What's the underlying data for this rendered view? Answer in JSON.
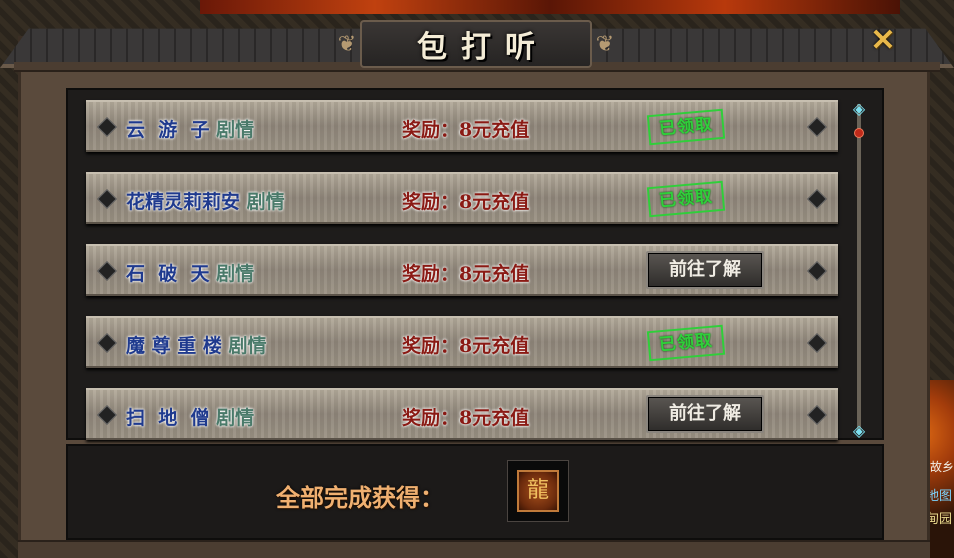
{
  "window": {
    "title": "包打听",
    "close_glyph": "✕"
  },
  "quests": [
    {
      "name": "云  游  子",
      "tag": "剧情",
      "reward_label": "奖励：",
      "reward_value": "8元充值",
      "status": "claimed",
      "status_text": "已领取"
    },
    {
      "name": "花精灵莉莉安",
      "tag": "剧情",
      "reward_label": "奖励：",
      "reward_value": "8元充值",
      "status": "claimed",
      "status_text": "已领取"
    },
    {
      "name": "石  破  天",
      "tag": "剧情",
      "reward_label": "奖励：",
      "reward_value": "8元充值",
      "status": "goto",
      "status_text": "前往了解"
    },
    {
      "name": "魔 尊 重 楼",
      "tag": "剧情",
      "reward_label": "奖励：",
      "reward_value": "8元充值",
      "status": "claimed",
      "status_text": "已领取"
    },
    {
      "name": "扫  地  僧",
      "tag": "剧情",
      "reward_label": "奖励：",
      "reward_value": "8元充值",
      "status": "goto",
      "status_text": "前往了解"
    }
  ],
  "completion": {
    "label": "全部完成获得：",
    "reward_icon": "dragon-emblem-icon"
  },
  "side": {
    "text1": "低头思故乡",
    "text2": "◁地图",
    "text3": "伊甸园"
  },
  "colors": {
    "quest_name": "#1f3a8e",
    "reward": "#8a1a14",
    "claimed_stamp": "#2fcf3a",
    "completion_label": "#f0b070"
  }
}
